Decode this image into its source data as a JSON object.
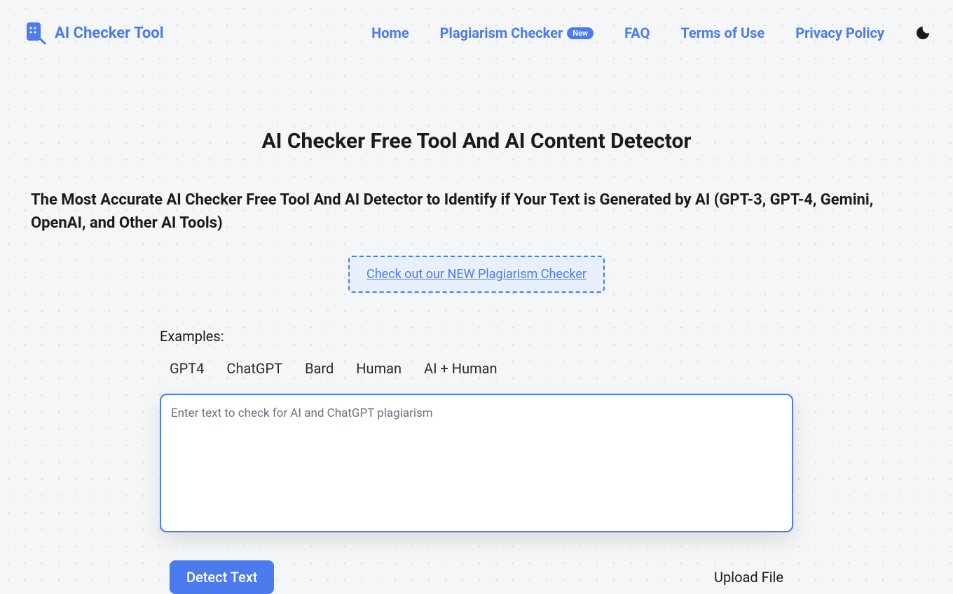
{
  "header": {
    "logo_text": "AI Checker Tool",
    "nav": {
      "home": "Home",
      "plagiarism": "Plagiarism Checker",
      "plagiarism_badge": "New",
      "faq": "FAQ",
      "terms": "Terms of Use",
      "privacy": "Privacy Policy"
    }
  },
  "main": {
    "title": "AI Checker Free Tool And AI Content Detector",
    "subtitle": "The Most Accurate AI Checker Free Tool And AI Detector to Identify if Your Text is Generated by AI (GPT-3, GPT-4, Gemini, OpenAI, and Other AI Tools)",
    "promo_text": "Check out our NEW Plagiarism Checker",
    "examples_label": "Examples:",
    "example_tabs": {
      "gpt4": "GPT4",
      "chatgpt": "ChatGPT",
      "bard": "Bard",
      "human": "Human",
      "ai_human": "AI + Human"
    },
    "textarea_placeholder": "Enter text to check for AI and ChatGPT plagiarism",
    "detect_button": "Detect Text",
    "upload_link": "Upload File"
  }
}
